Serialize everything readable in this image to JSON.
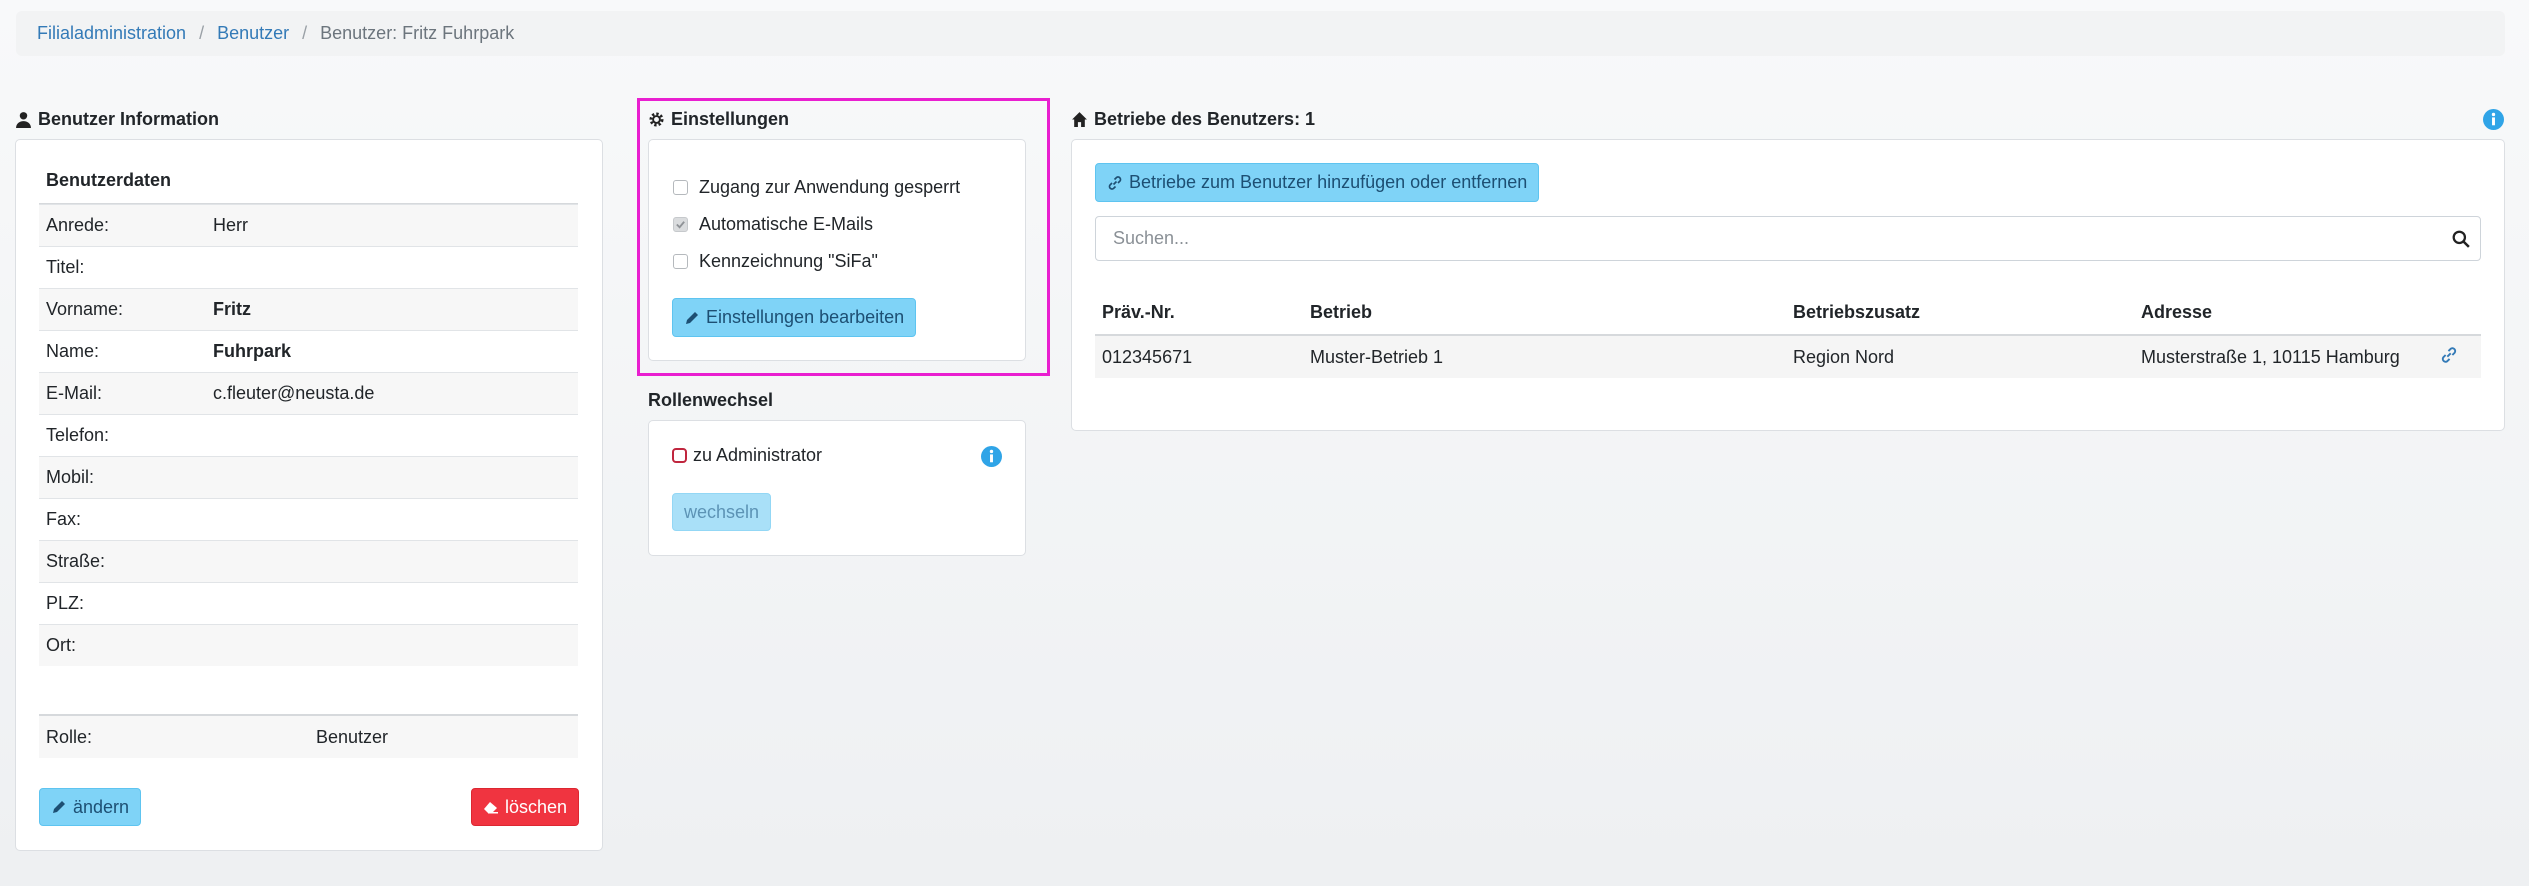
{
  "breadcrumb": [
    "Filialadministration",
    "Benutzer",
    "Benutzer: Fritz Fuhrpark"
  ],
  "user_info": {
    "title": "Benutzer Information",
    "section_head": "Benutzerdaten",
    "fields": [
      {
        "label": "Anrede:",
        "value": "Herr"
      },
      {
        "label": "Titel:",
        "value": ""
      },
      {
        "label": "Vorname:",
        "value": "Fritz"
      },
      {
        "label": "Name:",
        "value": "Fuhrpark"
      },
      {
        "label": "E-Mail:",
        "value": "c.fleuter@neusta.de"
      },
      {
        "label": "Telefon:",
        "value": ""
      },
      {
        "label": "Mobil:",
        "value": ""
      },
      {
        "label": "Fax:",
        "value": ""
      },
      {
        "label": "Straße:",
        "value": ""
      },
      {
        "label": "PLZ:",
        "value": ""
      },
      {
        "label": "Ort:",
        "value": ""
      }
    ],
    "role_label": "Rolle:",
    "role_value": "Benutzer",
    "edit_label": "ändern",
    "delete_label": "löschen"
  },
  "settings": {
    "title": "Einstellungen",
    "options": [
      {
        "label": "Zugang zur Anwendung gesperrt",
        "checked": false
      },
      {
        "label": "Automatische E-Mails",
        "checked": true
      },
      {
        "label": "Kennzeichnung \"SiFa\"",
        "checked": false
      }
    ],
    "edit_label": "Einstellungen bearbeiten"
  },
  "role_switch": {
    "title": "Rollenwechsel",
    "option": "zu Administrator",
    "button": "wechseln"
  },
  "businesses": {
    "title": "Betriebe des Benutzers: 1",
    "manage_label": "Betriebe zum Benutzer hinzufügen oder entfernen",
    "search_placeholder": "Suchen...",
    "columns": [
      "Präv.-Nr.",
      "Betrieb",
      "Betriebszusatz",
      "Adresse"
    ],
    "rows": [
      [
        "012345671",
        "Muster-Betrieb 1",
        "Region Nord",
        "Musterstraße 1, 10115 Hamburg"
      ]
    ]
  },
  "colors": {
    "accent": "#7fd3f7",
    "danger": "#f03440",
    "highlight": "#e91fd0",
    "link": "#337ab7"
  }
}
